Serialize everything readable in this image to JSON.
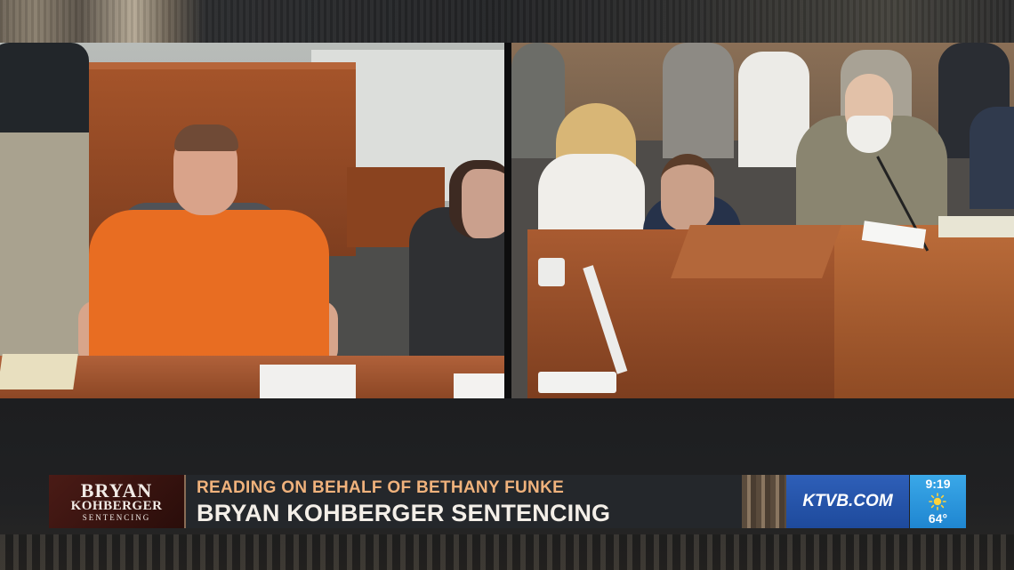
{
  "lower_third": {
    "show_logo": {
      "line1": "BRYAN",
      "line2": "KOHBERGER",
      "line3": "SENTENCING"
    },
    "subheadline": "READING ON BEHALF OF BETHANY FUNKE",
    "headline": "BRYAN KOHBERGER SENTENCING",
    "brand": "KTVB.COM",
    "weather": {
      "time": "9:19",
      "icon": "sun-icon",
      "temperature": "64°"
    }
  },
  "colors": {
    "subheadline": "#f0b27c",
    "brand_bg": "#2e5fb8",
    "weather_bg": "#3aa8e8",
    "logo_bg": "#4a1b16",
    "defendant_jumpsuit": "#e86d22"
  }
}
